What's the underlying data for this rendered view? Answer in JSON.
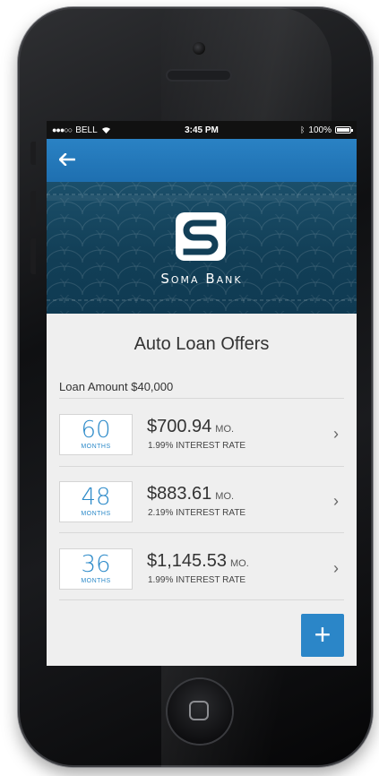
{
  "status_bar": {
    "carrier": "BELL",
    "time": "3:45 PM",
    "battery": "100%"
  },
  "brand": {
    "name": "Soma Bank"
  },
  "page": {
    "title": "Auto Loan Offers",
    "loan_amount_label": "Loan Amount $40,000"
  },
  "offers": [
    {
      "months": "60",
      "months_label": "MONTHS",
      "payment": "$700.94",
      "unit": "MO.",
      "rate": "1.99% INTEREST RATE"
    },
    {
      "months": "48",
      "months_label": "MONTHS",
      "payment": "$883.61",
      "unit": "MO.",
      "rate": "2.19% INTEREST RATE"
    },
    {
      "months": "36",
      "months_label": "MONTHS",
      "payment": "$1,145.53",
      "unit": "MO.",
      "rate": "1.99% INTEREST RATE"
    }
  ],
  "actions": {
    "add_label": "+"
  },
  "colors": {
    "nav_blue": "#1e6fb0",
    "banner_teal": "#123f57",
    "accent_blue": "#2c8ac9"
  },
  "icons": {
    "back": "arrow-left-icon",
    "chevron": "chevron-right-icon",
    "add": "plus-icon",
    "wifi": "wifi-icon",
    "bluetooth": "bluetooth-icon",
    "battery": "battery-icon"
  }
}
